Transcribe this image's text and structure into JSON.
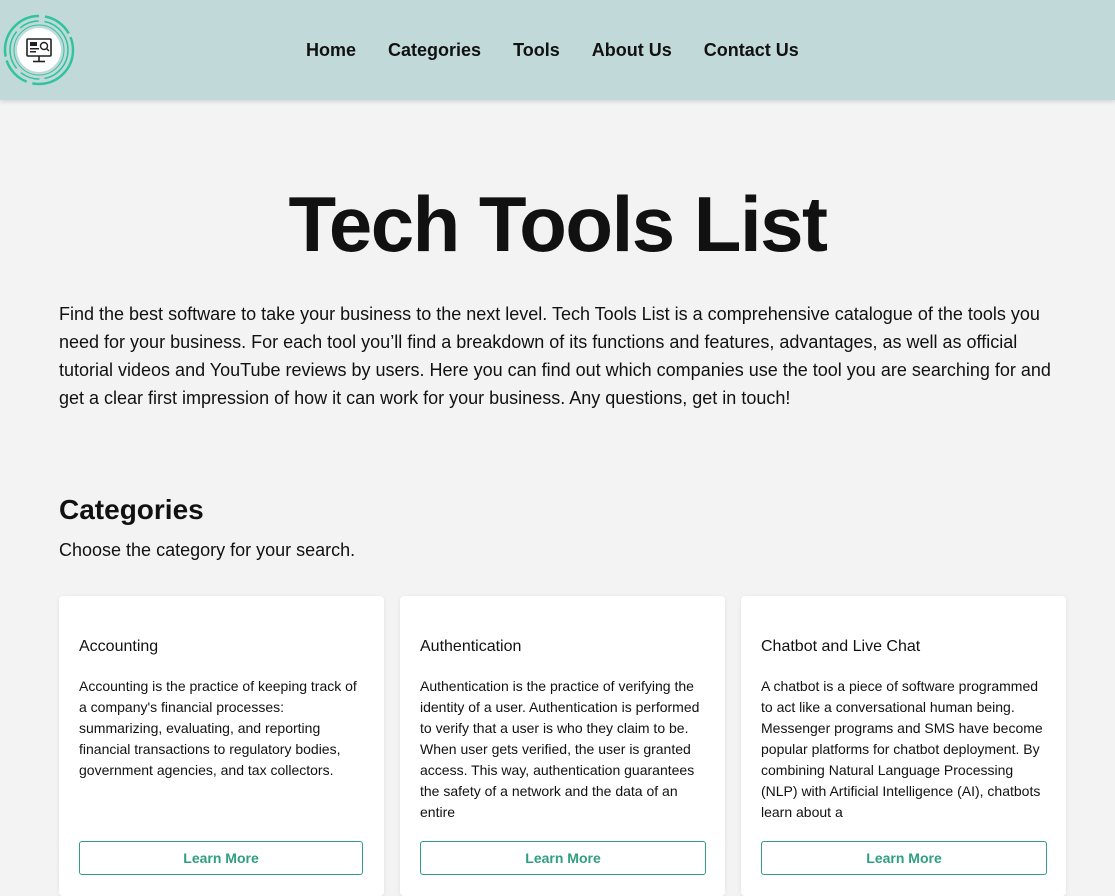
{
  "nav": {
    "logo_icon": "computer-monitor-logo-icon",
    "links": [
      "Home",
      "Categories",
      "Tools",
      "About Us",
      "Contact Us"
    ]
  },
  "hero": {
    "title": "Tech Tools List",
    "intro": "Find the best software to take your business to the next level. Tech Tools List is a comprehensive catalogue of the tools you need for your business. For each tool you’ll find a breakdown of its functions and features, advantages, as well as official tutorial videos and YouTube reviews by users. Here you can find out which companies use the tool you are searching for and get a clear first impression of how it can work for your business. Any questions, get in touch!"
  },
  "categories": {
    "title": "Categories",
    "subtitle": "Choose the category for your search.",
    "cards": [
      {
        "title": "Accounting",
        "text": "Accounting is the practice of keeping track of a company's financial processes: summarizing, evaluating, and reporting financial transactions to regulatory bodies, government agencies, and tax collectors.",
        "button": "Learn More"
      },
      {
        "title": "Authentication",
        "text": "Authentication is the practice of verifying the identity of a user. Authentication is performed to verify that a user is who they claim to be. When user gets verified, the user is granted access. This way, authentication guarantees the safety of a network and the data of an entire",
        "button": "Learn More"
      },
      {
        "title": "Chatbot and Live Chat",
        "text": "A chatbot is a piece of software programmed to act like a conversational human being. Messenger programs and SMS have become popular platforms for chatbot deployment. By combining Natural Language Processing (NLP) with Artificial Intelligence (AI), chatbots learn about a",
        "button": "Learn More"
      }
    ]
  },
  "colors": {
    "navbar_bg": "#c2d9da",
    "page_bg": "#f3f3f3",
    "accent": "#2f9e83"
  }
}
